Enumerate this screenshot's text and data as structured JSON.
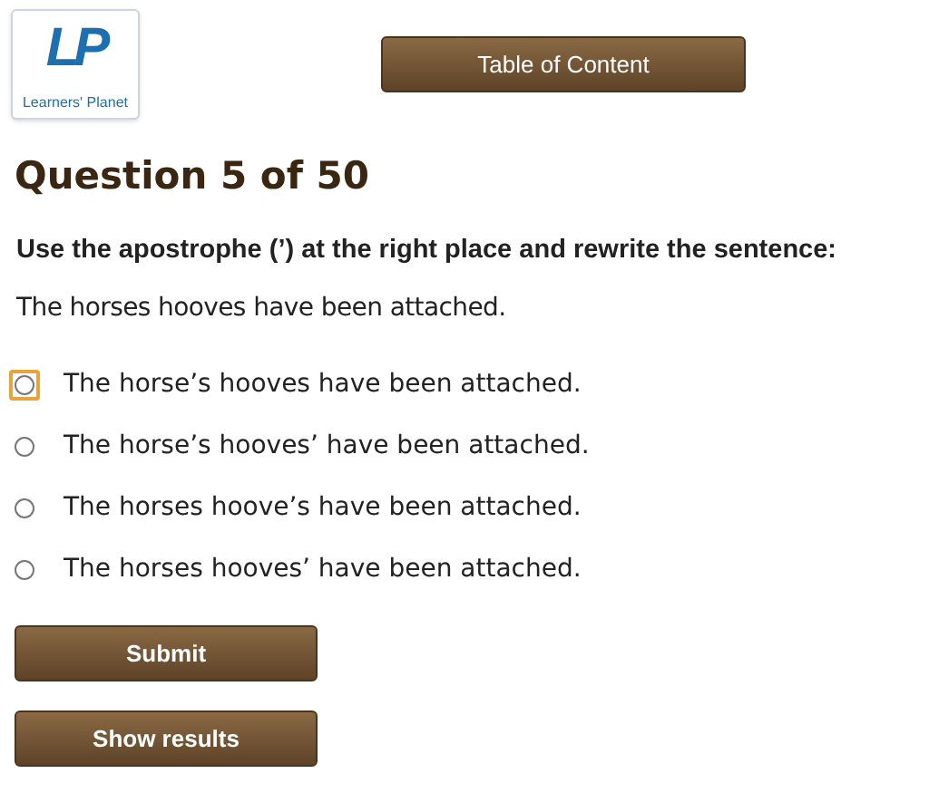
{
  "logo": {
    "mark": "LP",
    "caption": "Learners' Planet"
  },
  "toc_button": "Table of Content",
  "heading": "Question 5 of 50",
  "instruction": "Use the apostrophe (’) at the right place and rewrite the sentence:",
  "sentence": "The horses hooves have been attached.",
  "options": [
    {
      "label": "The horse’s hooves have been attached.",
      "selected": false,
      "focused": true
    },
    {
      "label": "The horse’s hooves’ have been attached.",
      "selected": false,
      "focused": false
    },
    {
      "label": "The horses hoove’s have been attached.",
      "selected": false,
      "focused": false
    },
    {
      "label": "The horses hooves’ have been attached.",
      "selected": false,
      "focused": false
    }
  ],
  "buttons": [
    "Submit",
    "Show results"
  ]
}
